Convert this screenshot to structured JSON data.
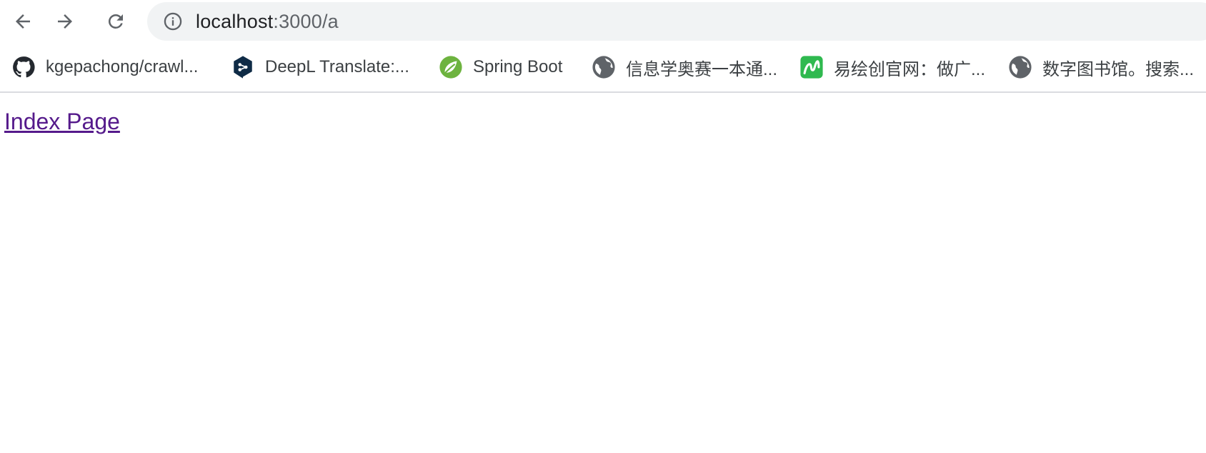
{
  "browser": {
    "url": {
      "host": "localhost",
      "path": ":3000/a"
    },
    "icons": {
      "back": "back-arrow-icon",
      "forward": "forward-arrow-icon",
      "reload": "reload-icon",
      "site_info": "info-icon"
    }
  },
  "bookmarks": [
    {
      "label": "kgepachong/crawl...",
      "icon": "github-icon"
    },
    {
      "label": "DeepL Translate:...",
      "icon": "deepl-icon"
    },
    {
      "label": "Spring Boot",
      "icon": "spring-leaf-icon"
    },
    {
      "label": "信息学奥赛一本通...",
      "icon": "globe-icon"
    },
    {
      "label": "易绘创官网：做广...",
      "icon": "green-app-icon"
    },
    {
      "label": "数字图书馆。搜索...",
      "icon": "globe-icon"
    }
  ],
  "page": {
    "link_text": "Index Page"
  },
  "colors": {
    "visited_link": "#551a8b",
    "omnibox_bg": "#f1f3f4",
    "spring_green": "#6db33f",
    "app_green": "#2fb94f",
    "deepl_navy": "#0f2b46"
  }
}
